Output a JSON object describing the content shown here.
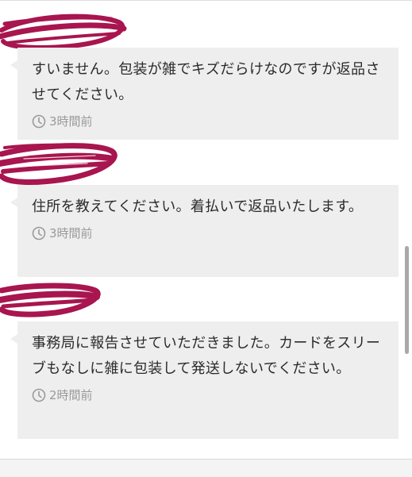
{
  "messages": [
    {
      "text": "すいません。包装が雑でキズだらけなのですが返品させてください。",
      "time": "3時間前"
    },
    {
      "text": "住所を教えてください。着払いで返品いたします。",
      "time": "3時間前"
    },
    {
      "text": "事務局に報告させていただきました。カードをスリーブもなしに雑に包装して発送しないでください。",
      "time": "2時間前"
    }
  ],
  "icons": {
    "time": "clock-icon"
  },
  "colors": {
    "bubble": "#eeeeee",
    "redaction": "#a8154f",
    "time_text": "#9a9a9a"
  }
}
